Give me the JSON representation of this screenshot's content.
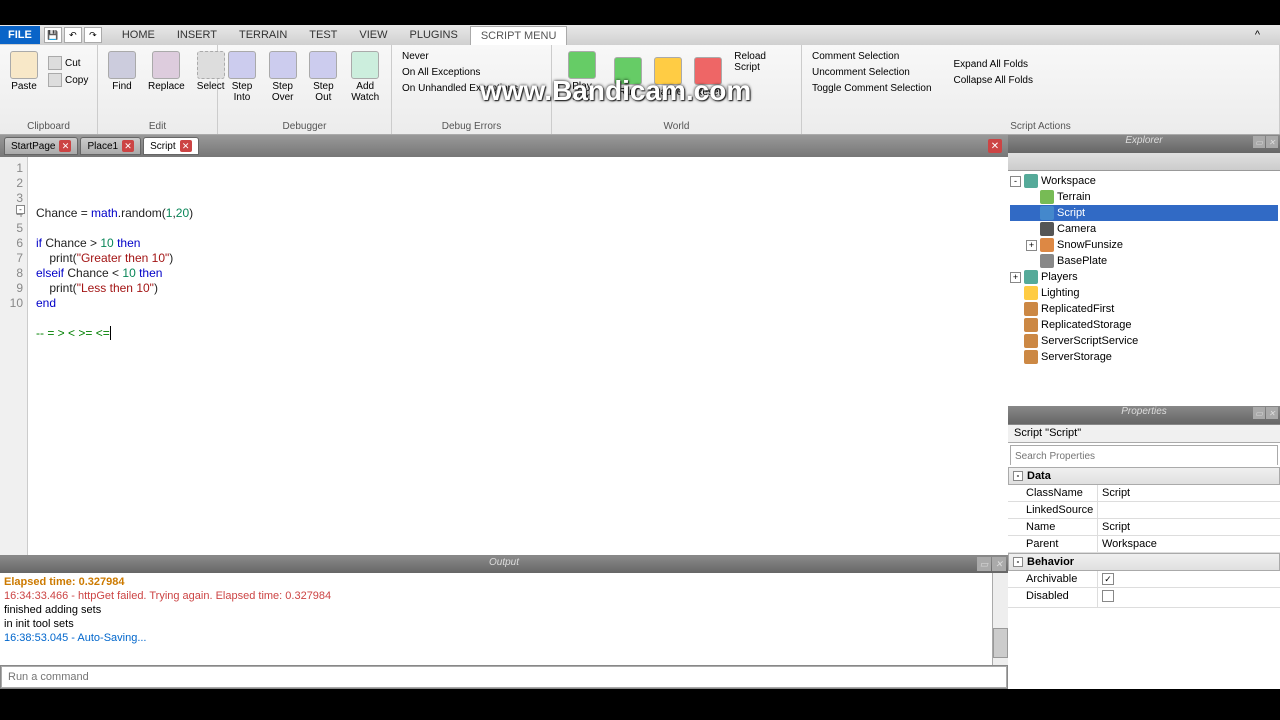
{
  "watermark": "www.Bandicam.com",
  "menubar": {
    "file": "FILE",
    "tabs": [
      "HOME",
      "INSERT",
      "TERRAIN",
      "TEST",
      "VIEW",
      "PLUGINS",
      "SCRIPT MENU"
    ],
    "active_tab": 6
  },
  "ribbon": {
    "clipboard": {
      "label": "Clipboard",
      "paste": "Paste",
      "cut": "Cut",
      "copy": "Copy"
    },
    "edit": {
      "label": "Edit",
      "find": "Find",
      "replace": "Replace",
      "select": "Select"
    },
    "debugger": {
      "label": "Debugger",
      "step_into": "Step\nInto",
      "step_over": "Step\nOver",
      "step_out": "Step\nOut",
      "add_watch": "Add\nWatch"
    },
    "debug_errors": {
      "label": "Debug Errors",
      "never": "Never",
      "on_all": "On All Exceptions",
      "on_unhandled": "On Unhandled Exceptions"
    },
    "world": {
      "label": "World",
      "play_solo": "Play\nSolo",
      "run": "Run",
      "pause": "Pause",
      "reset": "Reset",
      "reload": "Reload Script"
    },
    "script_actions": {
      "label": "Script Actions",
      "comment": "Comment Selection",
      "uncomment": "Uncomment Selection",
      "toggle_comment": "Toggle Comment Selection",
      "expand": "Expand All Folds",
      "collapse": "Collapse All Folds"
    }
  },
  "doc_tabs": [
    {
      "label": "StartPage",
      "active": false
    },
    {
      "label": "Place1",
      "active": false
    },
    {
      "label": "Script",
      "active": true
    }
  ],
  "code": {
    "lines": [
      "1",
      "2",
      "3",
      "4",
      "5",
      "6",
      "7",
      "8",
      "9",
      "10"
    ],
    "content": {
      "l2_a": "Chance = ",
      "l2_b": "math",
      "l2_c": ".random(",
      "l2_d": "1",
      "l2_e": ",",
      "l2_f": "20",
      "l2_g": ")",
      "l4_a": "if",
      "l4_b": " Chance > ",
      "l4_c": "10",
      "l4_d": " ",
      "l4_e": "then",
      "l5_a": "    print(",
      "l5_b": "\"Greater then 10\"",
      "l5_c": ")",
      "l6_a": "elseif",
      "l6_b": " Chance < ",
      "l6_c": "10",
      "l6_d": " ",
      "l6_e": "then",
      "l7_a": "    print(",
      "l7_b": "\"Less then 10\"",
      "l7_c": ")",
      "l8_a": "end",
      "l10_a": "-- = > < >= <="
    }
  },
  "output": {
    "title": "Output",
    "lines": [
      {
        "cls": "out-warn",
        "text": "Elapsed time: 0.327984"
      },
      {
        "cls": "out-err",
        "text": "16:34:33.466 - httpGet failed. Trying again. Elapsed time: 0.327984"
      },
      {
        "cls": "",
        "text": "finished adding sets"
      },
      {
        "cls": "",
        "text": "in init tool sets"
      },
      {
        "cls": "out-info",
        "text": "16:38:53.045 - Auto-Saving..."
      }
    ]
  },
  "command_placeholder": "Run a command",
  "explorer": {
    "title": "Explorer",
    "items": [
      {
        "indent": 0,
        "toggle": "-",
        "icon": "#5a9",
        "label": "Workspace"
      },
      {
        "indent": 1,
        "toggle": "",
        "icon": "#7b5",
        "label": "Terrain"
      },
      {
        "indent": 1,
        "toggle": "",
        "icon": "#48c",
        "label": "Script",
        "selected": true
      },
      {
        "indent": 1,
        "toggle": "",
        "icon": "#555",
        "label": "Camera"
      },
      {
        "indent": 1,
        "toggle": "+",
        "icon": "#d84",
        "label": "SnowFunsize"
      },
      {
        "indent": 1,
        "toggle": "",
        "icon": "#888",
        "label": "BasePlate"
      },
      {
        "indent": 0,
        "toggle": "+",
        "icon": "#5a9",
        "label": "Players"
      },
      {
        "indent": 0,
        "toggle": "",
        "icon": "#fc4",
        "label": "Lighting"
      },
      {
        "indent": 0,
        "toggle": "",
        "icon": "#c84",
        "label": "ReplicatedFirst"
      },
      {
        "indent": 0,
        "toggle": "",
        "icon": "#c84",
        "label": "ReplicatedStorage"
      },
      {
        "indent": 0,
        "toggle": "",
        "icon": "#c84",
        "label": "ServerScriptService"
      },
      {
        "indent": 0,
        "toggle": "",
        "icon": "#c84",
        "label": "ServerStorage"
      }
    ]
  },
  "properties": {
    "title": "Properties",
    "header": "Script \"Script\"",
    "search_placeholder": "Search Properties",
    "sections": [
      {
        "name": "Data",
        "rows": [
          {
            "name": "ClassName",
            "val": "Script"
          },
          {
            "name": "LinkedSource",
            "val": ""
          },
          {
            "name": "Name",
            "val": "Script"
          },
          {
            "name": "Parent",
            "val": "Workspace"
          }
        ]
      },
      {
        "name": "Behavior",
        "rows": [
          {
            "name": "Archivable",
            "val": "check",
            "checked": true
          },
          {
            "name": "Disabled",
            "val": "check",
            "checked": false
          }
        ]
      }
    ]
  }
}
